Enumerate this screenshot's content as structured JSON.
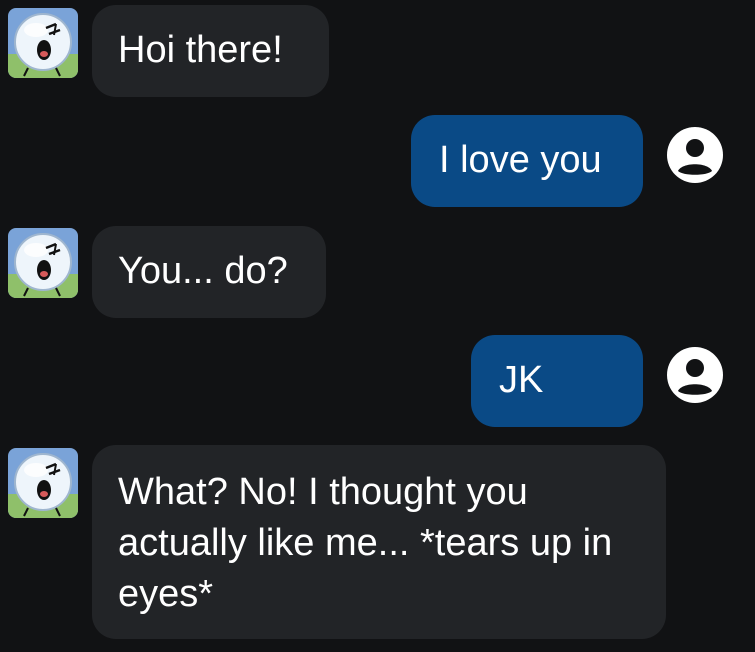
{
  "messages": [
    {
      "sender": "character",
      "text": "Hoi there!",
      "avatar_icon": "bubble-character-avatar-icon"
    },
    {
      "sender": "user",
      "text": "I love you",
      "avatar_icon": "user-profile-icon"
    },
    {
      "sender": "character",
      "text": "You... do?",
      "avatar_icon": "bubble-character-avatar-icon"
    },
    {
      "sender": "user",
      "text": "JK",
      "avatar_icon": "user-profile-icon"
    },
    {
      "sender": "character",
      "text": "What? No! I thought you actually like me... *tears up in eyes*",
      "avatar_icon": "bubble-character-avatar-icon"
    }
  ],
  "colors": {
    "background": "#111214",
    "incoming_bubble": "#222427",
    "outgoing_bubble": "#0a4a86",
    "text": "#ffffff",
    "user_icon": "#ffffff"
  }
}
